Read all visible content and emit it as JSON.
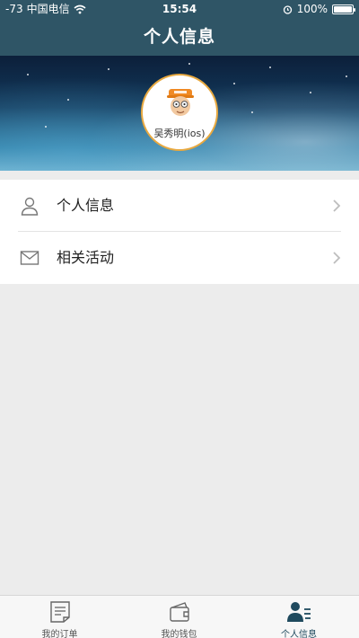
{
  "status_bar": {
    "signal": "-73",
    "carrier": "中国电信",
    "time": "15:54",
    "battery": "100%"
  },
  "nav": {
    "title": "个人信息"
  },
  "profile": {
    "name": "吴秀明(ios)"
  },
  "menu": {
    "items": [
      {
        "label": "个人信息",
        "icon": "person-icon"
      },
      {
        "label": "相关活动",
        "icon": "envelope-icon"
      }
    ]
  },
  "tabbar": {
    "tabs": [
      {
        "label": "我的订单",
        "icon": "document-icon",
        "active": false
      },
      {
        "label": "我的钱包",
        "icon": "wallet-icon",
        "active": false
      },
      {
        "label": "个人信息",
        "icon": "profile-icon",
        "active": true
      }
    ]
  },
  "colors": {
    "nav_bg": "#2f5566",
    "accent": "#1f4a5e",
    "avatar_ring": "#e8a940",
    "page_bg": "#ececec"
  }
}
